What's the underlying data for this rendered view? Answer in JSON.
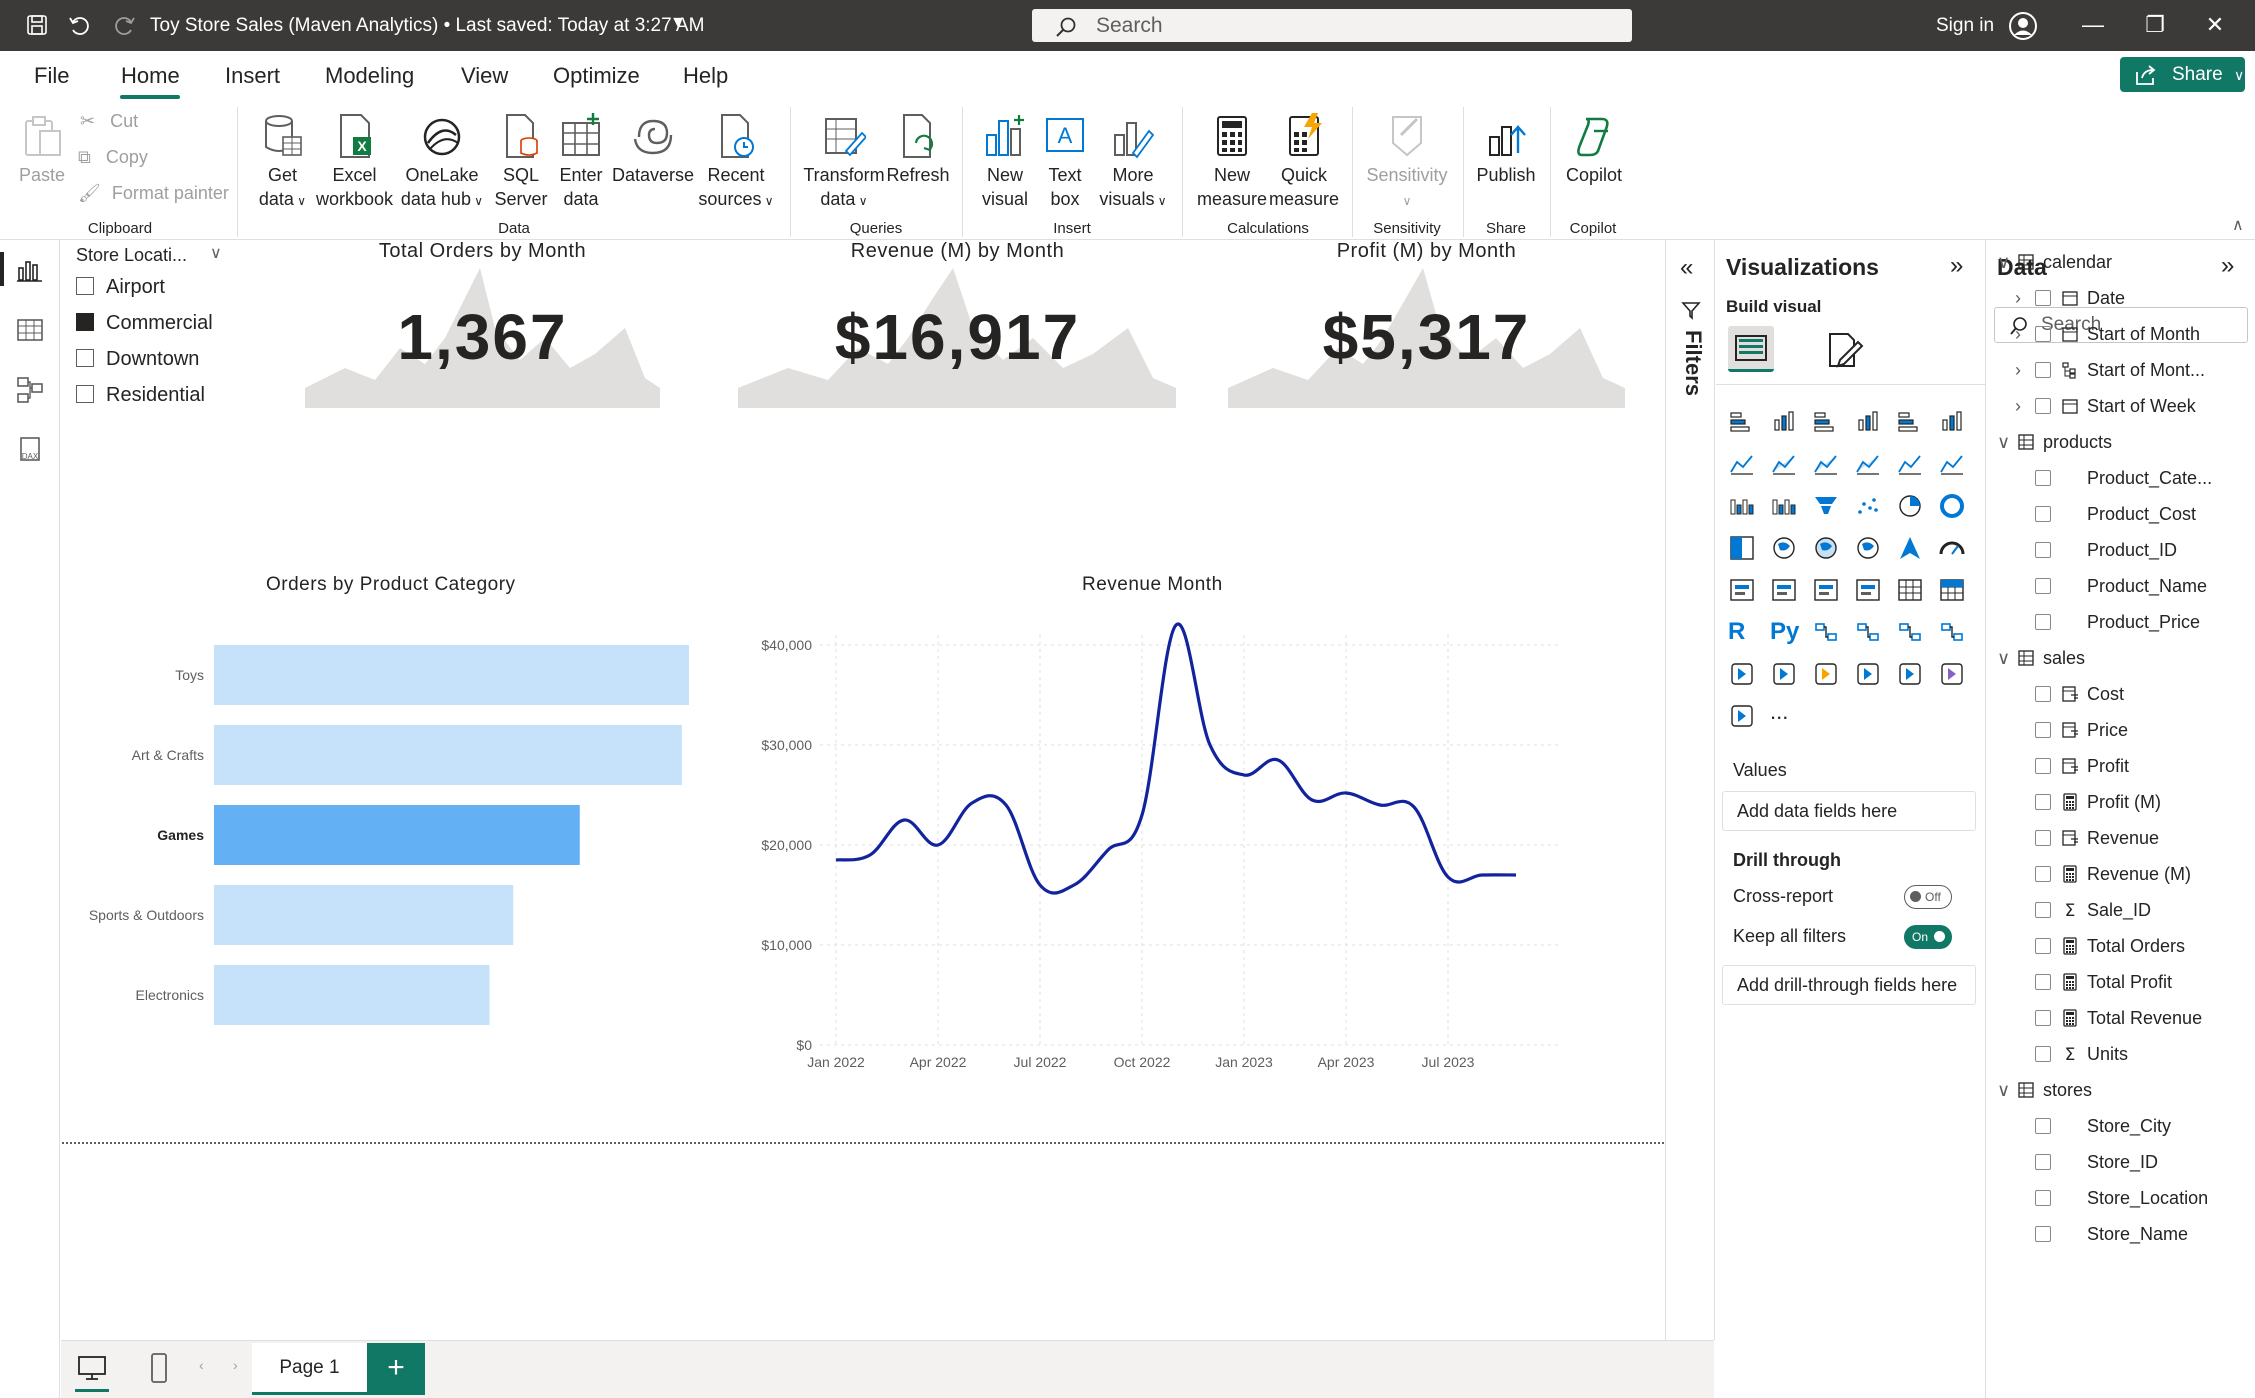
{
  "titlebar": {
    "title": "Toy Store Sales (Maven Analytics) • Last saved: Today at 3:27 AM",
    "search_placeholder": "Search",
    "signin": "Sign in"
  },
  "menu": {
    "tabs": [
      "File",
      "Home",
      "Insert",
      "Modeling",
      "View",
      "Optimize",
      "Help"
    ],
    "active": "Home",
    "share_label": "Share"
  },
  "ribbon": {
    "clipboard": {
      "paste": "Paste",
      "cut": "Cut",
      "copy": "Copy",
      "format_painter": "Format painter",
      "label": "Clipboard"
    },
    "data": {
      "get_data": [
        "Get",
        "data"
      ],
      "excel": [
        "Excel",
        "workbook"
      ],
      "onelake": [
        "OneLake",
        "data hub"
      ],
      "sql": [
        "SQL",
        "Server"
      ],
      "enter": [
        "Enter",
        "data"
      ],
      "dataverse": "Dataverse",
      "recent": [
        "Recent",
        "sources"
      ],
      "label": "Data"
    },
    "queries": {
      "transform": [
        "Transform",
        "data"
      ],
      "refresh": "Refresh",
      "label": "Queries"
    },
    "insert": {
      "new_visual": [
        "New",
        "visual"
      ],
      "text_box": [
        "Text",
        "box"
      ],
      "more_visuals": [
        "More",
        "visuals"
      ],
      "label": "Insert"
    },
    "calculations": {
      "new_measure": [
        "New",
        "measure"
      ],
      "quick_measure": [
        "Quick",
        "measure"
      ],
      "label": "Calculations"
    },
    "sensitivity": {
      "button": "Sensitivity",
      "label": "Sensitivity"
    },
    "share": {
      "publish": "Publish",
      "label": "Share"
    },
    "copilot": {
      "button": "Copilot",
      "label": "Copilot"
    }
  },
  "slicer": {
    "title": "Store Locati...",
    "items": [
      {
        "label": "Airport",
        "checked": false
      },
      {
        "label": "Commercial",
        "checked": true
      },
      {
        "label": "Downtown",
        "checked": false
      },
      {
        "label": "Residential",
        "checked": false
      }
    ]
  },
  "cards": [
    {
      "title": "Total Orders by Month",
      "value": "1,367"
    },
    {
      "title": "Revenue (M) by Month",
      "value": "$16,917"
    },
    {
      "title": "Profit (M) by Month",
      "value": "$5,317"
    }
  ],
  "chart_data": [
    {
      "type": "bar",
      "orientation": "horizontal",
      "title": "Orders by Product Category",
      "categories": [
        "Toys",
        "Art & Crafts",
        "Games",
        "Sports & Outdoors",
        "Electronics"
      ],
      "values": [
        100,
        98.5,
        77,
        63,
        58
      ],
      "highlighted": "Games",
      "colors": {
        "bar": "#c6e2fb",
        "highlight": "#64b0f5"
      }
    },
    {
      "type": "line",
      "title": "Revenue Month",
      "x": [
        "Jan 2022",
        "Feb 2022",
        "Mar 2022",
        "Apr 2022",
        "May 2022",
        "Jun 2022",
        "Jul 2022",
        "Aug 2022",
        "Sep 2022",
        "Oct 2022",
        "Nov 2022",
        "Dec 2022",
        "Jan 2023",
        "Feb 2023",
        "Mar 2023",
        "Apr 2023",
        "May 2023",
        "Jun 2023",
        "Jul 2023",
        "Aug 2023",
        "Sep 2023"
      ],
      "values": [
        18500,
        19000,
        22500,
        20000,
        24200,
        24000,
        16000,
        16000,
        19500,
        23000,
        42000,
        30000,
        27000,
        28500,
        24500,
        25200,
        24000,
        23800,
        16800,
        17000,
        17000
      ],
      "x_ticks": [
        "Jan 2022",
        "Apr 2022",
        "Jul 2022",
        "Oct 2022",
        "Jan 2023",
        "Apr 2023",
        "Jul 2023"
      ],
      "y_ticks": [
        "$0",
        "$10,000",
        "$20,000",
        "$30,000",
        "$40,000"
      ],
      "ylim": [
        0,
        40000
      ],
      "grid": true,
      "color": "#12239e"
    }
  ],
  "filters_label": "Filters",
  "visualizations": {
    "title": "Visualizations",
    "build_visual": "Build visual",
    "values_label": "Values",
    "values_placeholder": "Add data fields here",
    "drill_through": "Drill through",
    "cross_report": "Cross-report",
    "cross_report_state": "Off",
    "keep_filters": "Keep all filters",
    "keep_filters_state": "On",
    "drill_placeholder": "Add drill-through fields here",
    "extra_icons": [
      "R",
      "Py"
    ],
    "more": "..."
  },
  "data_pane": {
    "title": "Data",
    "search_placeholder": "Search",
    "tables": [
      {
        "name": "calendar",
        "fields": [
          {
            "name": "Date",
            "expand": true,
            "icon": "calendar"
          },
          {
            "name": "Start of Month",
            "expand": true,
            "icon": "calendar"
          },
          {
            "name": "Start of Mont...",
            "expand": true,
            "icon": "hierarchy"
          },
          {
            "name": "Start of Week",
            "expand": true,
            "icon": "calendar"
          }
        ]
      },
      {
        "name": "products",
        "fields": [
          {
            "name": "Product_Cate...",
            "icon": "none"
          },
          {
            "name": "Product_Cost",
            "icon": "none"
          },
          {
            "name": "Product_ID",
            "icon": "none"
          },
          {
            "name": "Product_Name",
            "icon": "none"
          },
          {
            "name": "Product_Price",
            "icon": "none"
          }
        ]
      },
      {
        "name": "sales",
        "fields": [
          {
            "name": "Cost",
            "icon": "calc-column"
          },
          {
            "name": "Price",
            "icon": "calc-column"
          },
          {
            "name": "Profit",
            "icon": "calc-column"
          },
          {
            "name": "Profit (M)",
            "icon": "measure"
          },
          {
            "name": "Revenue",
            "icon": "calc-column"
          },
          {
            "name": "Revenue (M)",
            "icon": "measure"
          },
          {
            "name": "Sale_ID",
            "icon": "sigma"
          },
          {
            "name": "Total Orders",
            "icon": "measure"
          },
          {
            "name": "Total Profit",
            "icon": "measure"
          },
          {
            "name": "Total Revenue",
            "icon": "measure"
          },
          {
            "name": "Units",
            "icon": "sigma"
          }
        ]
      },
      {
        "name": "stores",
        "fields": [
          {
            "name": "Store_City",
            "icon": "none"
          },
          {
            "name": "Store_ID",
            "icon": "none"
          },
          {
            "name": "Store_Location",
            "icon": "none"
          },
          {
            "name": "Store_Name",
            "icon": "none"
          }
        ]
      }
    ]
  },
  "bottombar": {
    "page_tab": "Page 1",
    "add_page": "+"
  }
}
